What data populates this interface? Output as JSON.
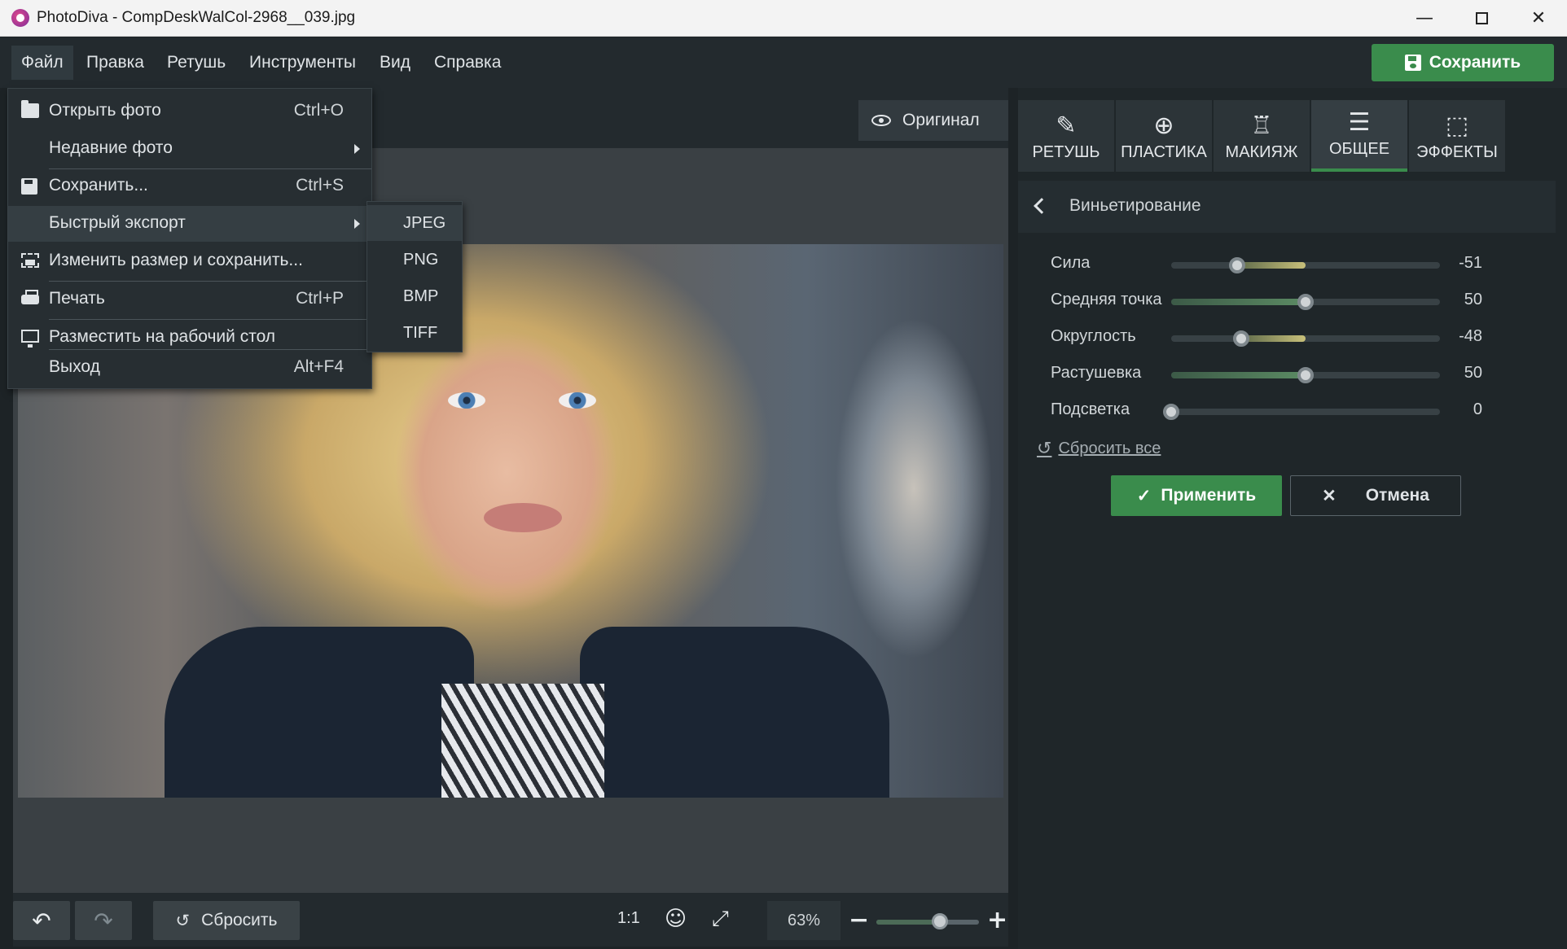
{
  "window": {
    "title": "PhotoDiva - CompDeskWalCol-2968__039.jpg",
    "minimize": "—",
    "close": "✕"
  },
  "menubar": {
    "items": [
      "Файл",
      "Правка",
      "Ретушь",
      "Инструменты",
      "Вид",
      "Справка"
    ],
    "save_label": "Сохранить"
  },
  "file_menu": {
    "items": [
      {
        "label": "Открыть фото",
        "shortcut": "Ctrl+O",
        "icon": "folder-icon"
      },
      {
        "label": "Недавние фото",
        "shortcut": "",
        "submenu": true
      },
      {
        "label": "Сохранить...",
        "shortcut": "Ctrl+S",
        "icon": "save-icon"
      },
      {
        "label": "Быстрый экспорт",
        "shortcut": "",
        "submenu": true
      },
      {
        "label": "Изменить размер и сохранить...",
        "shortcut": "",
        "icon": "resize-icon"
      },
      {
        "label": "Печать",
        "shortcut": "Ctrl+P",
        "icon": "printer-icon"
      },
      {
        "label": "Разместить на рабочий стол",
        "shortcut": "",
        "icon": "desktop-icon"
      },
      {
        "label": "Выход",
        "shortcut": "Alt+F4"
      }
    ]
  },
  "export_submenu": {
    "items": [
      "JPEG",
      "PNG",
      "BMP",
      "TIFF"
    ]
  },
  "canvas": {
    "original_label": "Оригинал"
  },
  "bottombar": {
    "reset_label": "Сбросить",
    "actual_size": "1:1",
    "zoom": "63%",
    "zoom_level": 0.62
  },
  "tabs": [
    {
      "label": "РЕТУШЬ",
      "icon": "retouch-icon"
    },
    {
      "label": "ПЛАСТИКА",
      "icon": "liquify-icon"
    },
    {
      "label": "МАКИЯЖ",
      "icon": "makeup-icon"
    },
    {
      "label": "ОБЩЕЕ",
      "icon": "sliders-icon",
      "active": true
    },
    {
      "label": "ЭФФЕКТЫ",
      "icon": "effects-icon"
    }
  ],
  "panel": {
    "title": "Виньетирование",
    "sliders": [
      {
        "label": "Сила",
        "value": "-51",
        "min": -100,
        "max": 100,
        "num": -51
      },
      {
        "label": "Средняя точка",
        "value": "50",
        "min": 0,
        "max": 100,
        "num": 50
      },
      {
        "label": "Округлость",
        "value": "-48",
        "min": -100,
        "max": 100,
        "num": -48
      },
      {
        "label": "Растушевка",
        "value": "50",
        "min": 0,
        "max": 100,
        "num": 50
      },
      {
        "label": "Подсветка",
        "value": "0",
        "min": 0,
        "max": 100,
        "num": 0
      }
    ],
    "reset_all": "Сбросить все",
    "apply": "Применить",
    "cancel": "Отмена"
  },
  "colors": {
    "accent": "#3a8c4c",
    "bg": "#1d2326"
  }
}
